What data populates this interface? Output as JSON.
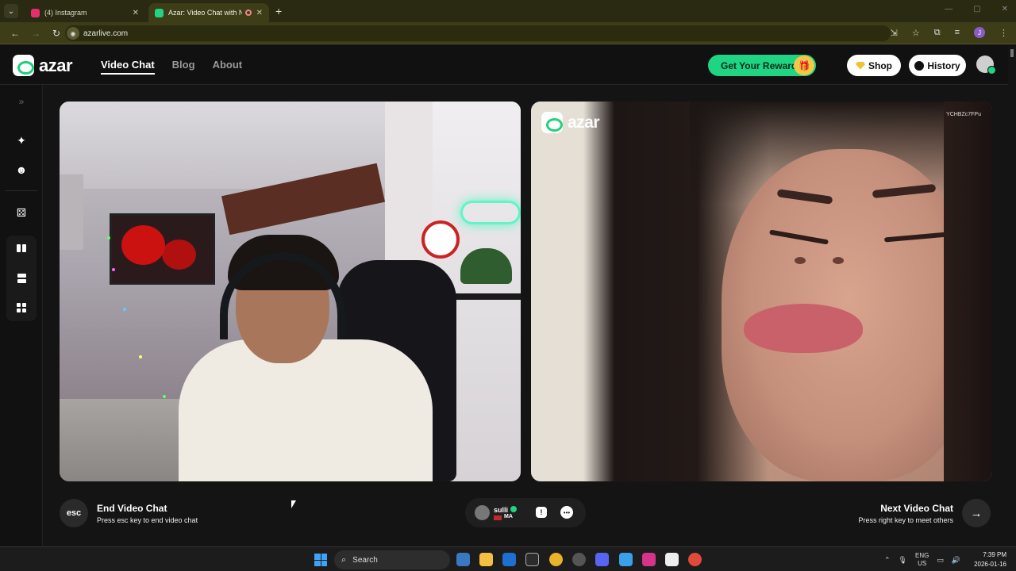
{
  "browser": {
    "tabs": [
      {
        "title": "(4) Instagram",
        "favicon_color": "#e1306c",
        "active": false
      },
      {
        "title": "Azar: Video Chat with New",
        "favicon_color": "#1fd482",
        "active": true
      }
    ],
    "url": "azarlive.com"
  },
  "site": {
    "logo_text": "azar",
    "nav": [
      {
        "label": "Video Chat",
        "active": true
      },
      {
        "label": "Blog",
        "active": false
      },
      {
        "label": "About",
        "active": false
      }
    ],
    "rewards_label": "Get Your Rewards!",
    "shop_label": "Shop",
    "history_label": "History",
    "accent_color": "#1fd482"
  },
  "sidebar": {
    "icons": [
      "expand-chevrons-icon",
      "magic-wand-icon",
      "emoji-face-icon",
      "dice-icon",
      "layout-side-by-side-icon",
      "layout-stacked-icon",
      "layout-grid-icon"
    ]
  },
  "remote_video": {
    "logo_text": "azar",
    "id_code": "YCHBZc7FPu"
  },
  "controls": {
    "esc_key": "esc",
    "end_title": "End Video Chat",
    "end_subtitle": "Press esc key to end video chat",
    "peer_name": "sulli",
    "peer_country": "MA",
    "next_title": "Next Video Chat",
    "next_subtitle": "Press right key to meet others"
  },
  "taskbar": {
    "search_placeholder": "Search",
    "lang_primary": "ENG",
    "lang_secondary": "US",
    "time": "7:39 PM",
    "date": "2026-01-16"
  }
}
